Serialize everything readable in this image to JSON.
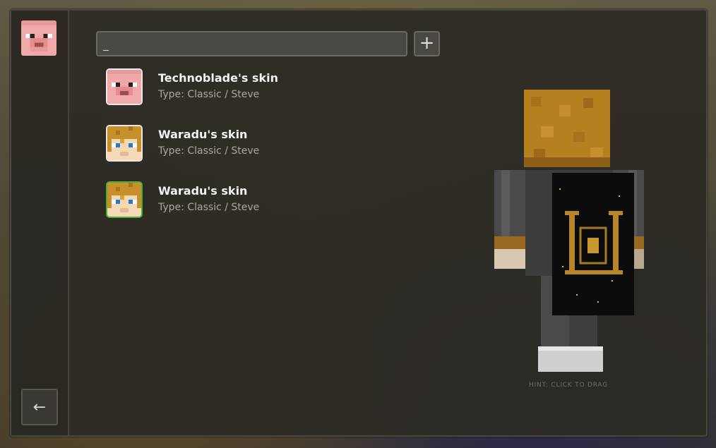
{
  "sidebar": {
    "current_skin_icon": "pig-head-icon",
    "back_icon": "arrow-left-icon"
  },
  "search": {
    "value": "_",
    "add_icon": "plus-icon",
    "add_label": "+"
  },
  "skins": [
    {
      "name": "Technoblade's skin",
      "type": "Type: Classic / Steve",
      "icon": "pig-head-icon",
      "selected": false
    },
    {
      "name": "Waradu's skin",
      "type": "Type: Classic / Steve",
      "icon": "blonde-head-icon",
      "selected": false
    },
    {
      "name": "Waradu's skin",
      "type": "Type: Classic / Steve",
      "icon": "blonde-head-icon",
      "selected": true
    }
  ],
  "preview": {
    "hint": "HINT: CLICK TO DRAG"
  },
  "colors": {
    "selected_border": "#4caf3a",
    "pig_pink": "#f0a8a8",
    "hair_gold": "#c8902a"
  }
}
